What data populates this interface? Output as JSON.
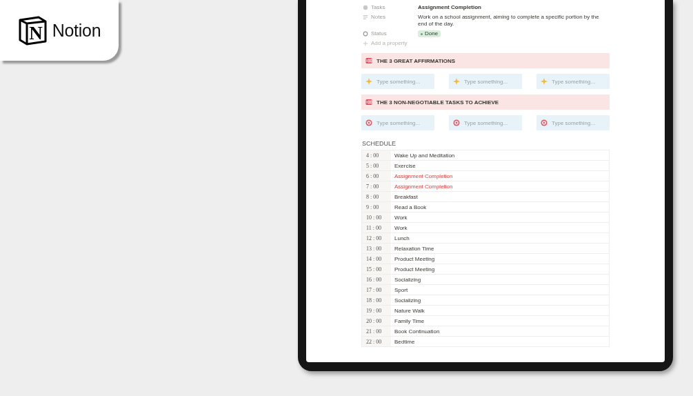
{
  "logo": {
    "mark": "N",
    "name": "Notion"
  },
  "properties": [
    {
      "kind": "text",
      "label": "Tasks",
      "value": "Assignment Completion"
    },
    {
      "kind": "notes",
      "label": "Notes",
      "value": "Work on a school assignment, aiming to complete a specific portion by the end of the day."
    },
    {
      "kind": "status",
      "label": "Status",
      "value": "Done"
    }
  ],
  "add_property": "Add a property",
  "sections": [
    {
      "title": "THE 3 GREAT AFFIRMATIONS",
      "kind": "sparkle",
      "inputs": [
        {
          "placeholder": "Type something..."
        },
        {
          "placeholder": "Type something..."
        },
        {
          "placeholder": "Type something..."
        }
      ]
    },
    {
      "title": "THE 3 NON-NEGOTIABLE TASKS TO ACHIEVE",
      "kind": "target",
      "inputs": [
        {
          "placeholder": "Type something..."
        },
        {
          "placeholder": "Type something..."
        },
        {
          "placeholder": "Type something..."
        }
      ]
    }
  ],
  "schedule": {
    "title": "SCHEDULE",
    "rows": [
      {
        "time": "4 : 00",
        "activity": "Wake Up and Meditation",
        "highlighted": false
      },
      {
        "time": "5 : 00",
        "activity": "Exercise",
        "highlighted": false
      },
      {
        "time": "6 : 00",
        "activity": "Assignment Completion",
        "highlighted": true
      },
      {
        "time": "7 : 00",
        "activity": "Assignment Completion",
        "highlighted": true
      },
      {
        "time": "8 : 00",
        "activity": "Breakfast",
        "highlighted": false
      },
      {
        "time": "9 : 00",
        "activity": "Read a Book",
        "highlighted": false
      },
      {
        "time": "10 : 00",
        "activity": "Work",
        "highlighted": false
      },
      {
        "time": "11 : 00",
        "activity": "Work",
        "highlighted": false
      },
      {
        "time": "12 : 00",
        "activity": "Lunch",
        "highlighted": false
      },
      {
        "time": "13 : 00",
        "activity": "Relaxation Time",
        "highlighted": false
      },
      {
        "time": "14 : 00",
        "activity": "Product Meeting",
        "highlighted": false
      },
      {
        "time": "15 : 00",
        "activity": "Product Meeting",
        "highlighted": false
      },
      {
        "time": "16 : 00",
        "activity": "Socializing",
        "highlighted": false
      },
      {
        "time": "17 : 00",
        "activity": "Sport",
        "highlighted": false
      },
      {
        "time": "18 : 00",
        "activity": "Socializing",
        "highlighted": false
      },
      {
        "time": "19 : 00",
        "activity": "Nature Walk",
        "highlighted": false
      },
      {
        "time": "20 : 00",
        "activity": "Family Time",
        "highlighted": false
      },
      {
        "time": "21 : 00",
        "activity": "Book Continuation",
        "highlighted": false
      },
      {
        "time": "22 : 00",
        "activity": "Bedtime",
        "highlighted": false
      }
    ]
  }
}
